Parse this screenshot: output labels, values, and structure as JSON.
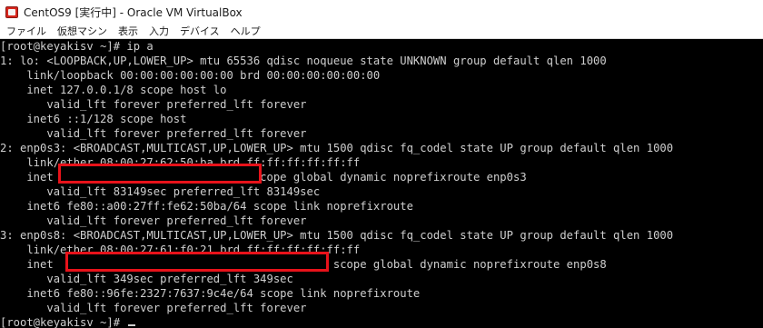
{
  "window": {
    "title": "CentOS9 [実行中] - Oracle VM VirtualBox",
    "app_icon": "virtualbox-icon"
  },
  "menubar": {
    "items": [
      "ファイル",
      "仮想マシン",
      "表示",
      "入力",
      "デバイス",
      "ヘルプ"
    ]
  },
  "terminal": {
    "colors": {
      "background": "#000000",
      "text": "#cfcfcf",
      "redaction": "#e8121a"
    },
    "lines": [
      "[root@keyakisv ~]# ip a",
      "1: lo: <LOOPBACK,UP,LOWER_UP> mtu 65536 qdisc noqueue state UNKNOWN group default qlen 1000",
      "    link/loopback 00:00:00:00:00:00 brd 00:00:00:00:00:00",
      "    inet 127.0.0.1/8 scope host lo",
      "       valid_lft forever preferred_lft forever",
      "    inet6 ::1/128 scope host",
      "       valid_lft forever preferred_lft forever",
      "2: enp0s3: <BROADCAST,MULTICAST,UP,LOWER_UP> mtu 1500 qdisc fq_codel state UP group default qlen 1000",
      "    link/ether 08:00:27:62:50:ba brd ff:ff:ff:ff:ff:ff",
      "    inet                              scope global dynamic noprefixroute enp0s3",
      "       valid_lft 83149sec preferred_lft 83149sec",
      "    inet6 fe80::a00:27ff:fe62:50ba/64 scope link noprefixroute",
      "       valid_lft forever preferred_lft forever",
      "3: enp0s8: <BROADCAST,MULTICAST,UP,LOWER_UP> mtu 1500 qdisc fq_codel state UP group default qlen 1000",
      "    link/ether 08:00:27:61:f0:21 brd ff:ff:ff:ff:ff:ff",
      "    inet                                          scope global dynamic noprefixroute enp0s8",
      "       valid_lft 349sec preferred_lft 349sec",
      "    inet6 fe80::96fe:2327:7637:9c4e/64 scope link noprefixroute",
      "       valid_lft forever preferred_lft forever",
      "[root@keyakisv ~]# "
    ]
  }
}
